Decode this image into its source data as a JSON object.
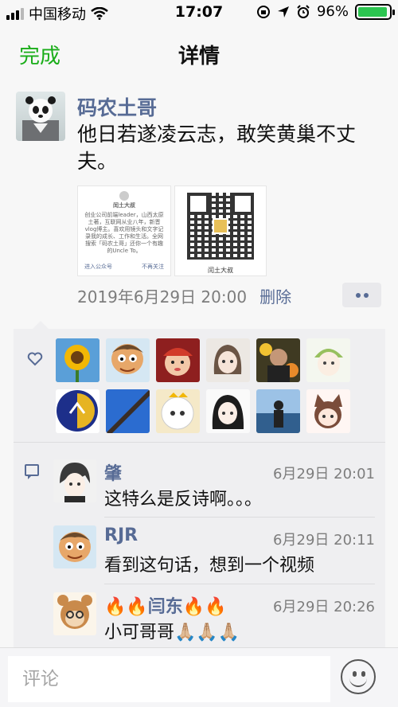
{
  "status_bar": {
    "carrier": "中国移动",
    "time": "17:07",
    "battery": "96%",
    "battery_level": 0.96
  },
  "nav": {
    "done_label": "完成",
    "title": "详情"
  },
  "post": {
    "author": "码农土哥",
    "text": "他日若遂凌云志，敢笑黄巢不丈夫。",
    "image1": {
      "title": "闰土大叔",
      "desc": "创业公司前端leader，山西太原土著，互联网从业八年，新晋vlog博主。喜欢用镜头和文字记录我的成长、工作和生活。全网搜索「码农土哥」还你一个有趣的Uncle To。",
      "footer_left": "进入公众号",
      "footer_right": "不再关注"
    },
    "image2": {
      "caption": "闰土大叔"
    },
    "timestamp": "2019年6月29日 20:00",
    "delete_label": "删除"
  },
  "likes": {
    "avatars": [
      "sunflower-avatar",
      "cartoon-boy-avatar",
      "baby-costume-avatar",
      "sketch-girl-avatar",
      "man-with-flowers-avatar",
      "anime-boy-avatar",
      "blue-logo-avatar",
      "bridge-photo-avatar",
      "lamb-cartoon-avatar",
      "anime-girl-avatar",
      "seaside-man-avatar",
      "cat-girl-avatar"
    ]
  },
  "comments": [
    {
      "name": "肇",
      "time": "6月29日 20:01",
      "text": "这特么是反诗啊。。。"
    },
    {
      "name": "RJR",
      "time": "6月29日 20:11",
      "text": "看到这句话，想到一个视频"
    },
    {
      "name": "🔥🔥闫东🔥🔥",
      "time": "6月29日 20:26",
      "text": "小可哥哥🙏🏼🙏🏼🙏🏼"
    }
  ],
  "input": {
    "placeholder": "评论"
  }
}
